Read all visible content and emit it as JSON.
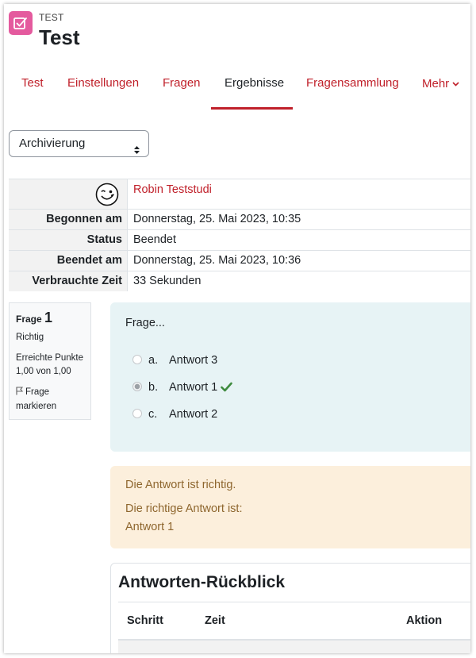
{
  "header": {
    "kicker": "TEST",
    "title": "Test"
  },
  "nav": {
    "tabs": [
      {
        "label": "Test"
      },
      {
        "label": "Einstellungen"
      },
      {
        "label": "Fragen"
      },
      {
        "label": "Ergebnisse"
      },
      {
        "label": "Fragensammlung"
      },
      {
        "label": "Mehr"
      }
    ],
    "active_tab": "Ergebnisse"
  },
  "report_select": {
    "value": "Archivierung"
  },
  "summary": {
    "user_name": "Robin Teststudi",
    "rows": [
      {
        "label": "Begonnen am",
        "value": "Donnerstag, 25. Mai 2023, 10:35"
      },
      {
        "label": "Status",
        "value": "Beendet"
      },
      {
        "label": "Beendet am",
        "value": "Donnerstag, 25. Mai 2023, 10:36"
      },
      {
        "label": "Verbrauchte Zeit",
        "value": "33 Sekunden"
      }
    ]
  },
  "question_info": {
    "label": "Frage",
    "number": "1",
    "state": "Richtig",
    "points_label": "Erreichte Punkte",
    "points_value": "1,00 von 1,00",
    "flag_line1": "Frage",
    "flag_line2": "markieren"
  },
  "question": {
    "text": "Frage...",
    "options": [
      {
        "letter": "a.",
        "text": "Antwort 3",
        "selected": false
      },
      {
        "letter": "b.",
        "text": "Antwort 1",
        "selected": true,
        "correct": true
      },
      {
        "letter": "c.",
        "text": "Antwort 2",
        "selected": false
      }
    ]
  },
  "feedback": {
    "result": "Die Antwort ist richtig.",
    "correct_label": "Die richtige Antwort ist:",
    "correct_answer": "Antwort 1"
  },
  "history": {
    "title": "Antworten-Rückblick",
    "columns": [
      "Schritt",
      "Zeit",
      "Aktion"
    ]
  },
  "colors": {
    "accent": "#c0202a",
    "icon_bg": "#e45a9e",
    "question_bg": "#e7f3f5",
    "feedback_bg": "#fcefdc",
    "feedback_text": "#8e662e",
    "check": "#3e8a3e"
  },
  "icons": {
    "activity": "checkbox-icon",
    "avatar": "smiley-icon",
    "flag": "flag-icon",
    "correct": "checkmark-icon",
    "select_caret": "updown-caret-icon",
    "more_caret": "chevron-down-icon"
  }
}
